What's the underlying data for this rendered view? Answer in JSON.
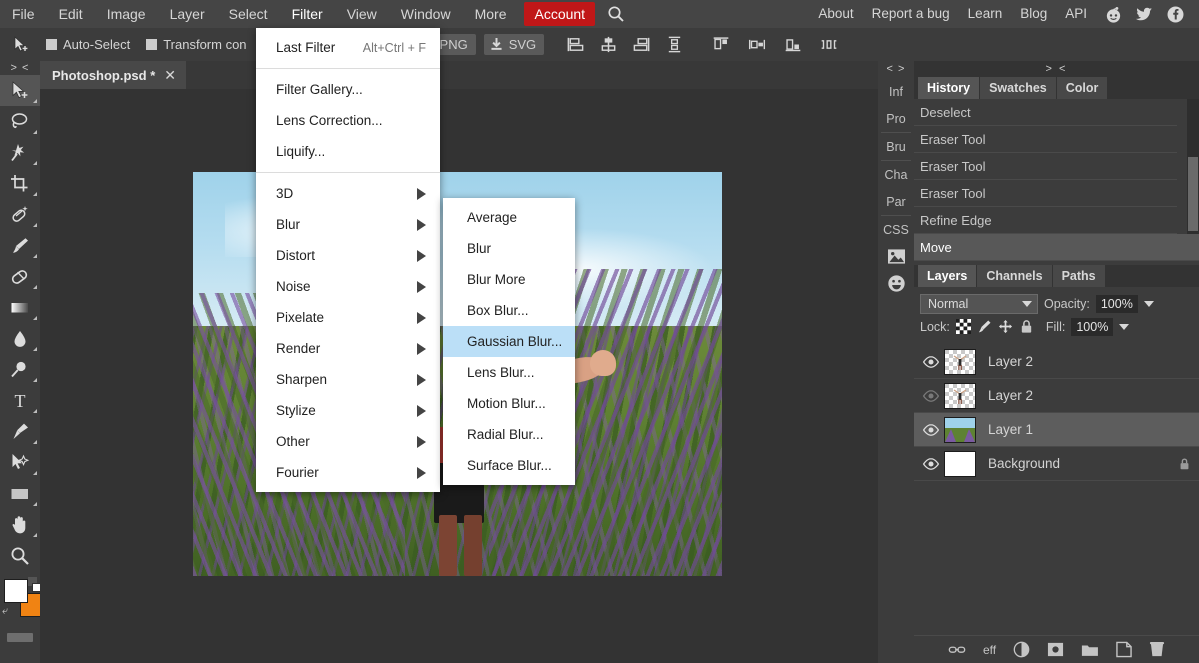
{
  "menubar": {
    "left_items": [
      "File",
      "Edit",
      "Image",
      "Layer",
      "Select",
      "Filter",
      "View",
      "Window",
      "More"
    ],
    "account_label": "Account",
    "search_icon": "search-icon",
    "right_items": [
      "About",
      "Report a bug",
      "Learn",
      "Blog",
      "API"
    ],
    "social_icons": [
      "reddit-icon",
      "twitter-icon",
      "facebook-icon"
    ],
    "accent_color": "#c01718"
  },
  "optionsbar": {
    "tool_icon": "move-tool-icon",
    "auto_select_label": "Auto-Select",
    "transform_label": "Transform con",
    "png_label": "PNG",
    "svg_label": "SVG",
    "align_icons": [
      "align-left-icon",
      "align-center-horizontal-icon",
      "align-right-icon",
      "distribute-vertical-icon"
    ],
    "align_icons2": [
      "align-top-icon",
      "align-middle-icon",
      "align-bottom-icon",
      "distribute-horizontal-icon"
    ]
  },
  "lefttools": {
    "collapse_label": "> <",
    "items": [
      {
        "name": "move-tool",
        "selected": true
      },
      {
        "name": "lasso-tool",
        "selected": false
      },
      {
        "name": "magic-wand-tool",
        "selected": false
      },
      {
        "name": "crop-tool",
        "selected": false
      },
      {
        "name": "healing-brush-tool",
        "selected": false
      },
      {
        "name": "brush-tool",
        "selected": false
      },
      {
        "name": "eraser-tool",
        "selected": false
      },
      {
        "name": "gradient-tool",
        "selected": false
      },
      {
        "name": "blur-tool",
        "selected": false
      },
      {
        "name": "dodge-tool",
        "selected": false
      },
      {
        "name": "type-tool",
        "selected": false
      },
      {
        "name": "pen-tool",
        "selected": false
      },
      {
        "name": "path-selection-tool",
        "selected": false
      },
      {
        "name": "rectangle-tool",
        "selected": false
      },
      {
        "name": "hand-tool",
        "selected": false
      },
      {
        "name": "zoom-tool",
        "selected": false
      }
    ],
    "foreground_color": "#ffffff",
    "background_color": "#f08313"
  },
  "document": {
    "tab_name": "Photoshop.psd *",
    "close_label": "✕"
  },
  "filter_menu": {
    "rows": [
      {
        "label": "Last Filter",
        "shortcut": "Alt+Ctrl + F",
        "submenu": false
      },
      {
        "separator": true
      },
      {
        "label": "Filter Gallery...",
        "shortcut": "",
        "submenu": false
      },
      {
        "label": "Lens Correction...",
        "shortcut": "",
        "submenu": false
      },
      {
        "label": "Liquify...",
        "shortcut": "",
        "submenu": false
      },
      {
        "separator": true
      },
      {
        "label": "3D",
        "shortcut": "",
        "submenu": true
      },
      {
        "label": "Blur",
        "shortcut": "",
        "submenu": true
      },
      {
        "label": "Distort",
        "shortcut": "",
        "submenu": true
      },
      {
        "label": "Noise",
        "shortcut": "",
        "submenu": true
      },
      {
        "label": "Pixelate",
        "shortcut": "",
        "submenu": true
      },
      {
        "label": "Render",
        "shortcut": "",
        "submenu": true
      },
      {
        "label": "Sharpen",
        "shortcut": "",
        "submenu": true
      },
      {
        "label": "Stylize",
        "shortcut": "",
        "submenu": true
      },
      {
        "label": "Other",
        "shortcut": "",
        "submenu": true
      },
      {
        "label": "Fourier",
        "shortcut": "",
        "submenu": true
      }
    ]
  },
  "blur_submenu": {
    "items": [
      {
        "label": "Average",
        "highlighted": false
      },
      {
        "label": "Blur",
        "highlighted": false
      },
      {
        "label": "Blur More",
        "highlighted": false
      },
      {
        "label": "Box Blur...",
        "highlighted": false
      },
      {
        "label": "Gaussian Blur...",
        "highlighted": true
      },
      {
        "label": "Lens Blur...",
        "highlighted": false
      },
      {
        "label": "Motion Blur...",
        "highlighted": false
      },
      {
        "label": "Radial Blur...",
        "highlighted": false
      },
      {
        "label": "Surface Blur...",
        "highlighted": false
      }
    ],
    "highlight_color": "#bbdff7"
  },
  "minibar": {
    "collapse_label": "< >",
    "items": [
      "Inf",
      "Pro",
      "Bru",
      "Cha",
      "Par",
      "CSS"
    ],
    "icon_items": [
      "image-icon",
      "emoji-icon"
    ]
  },
  "history_panel": {
    "collapse_label": "> <",
    "tabs": [
      {
        "label": "History",
        "selected": true
      },
      {
        "label": "Swatches",
        "selected": false
      },
      {
        "label": "Color",
        "selected": false
      }
    ],
    "items": [
      {
        "label": "Deselect",
        "selected": false
      },
      {
        "label": "Eraser Tool",
        "selected": false
      },
      {
        "label": "Eraser Tool",
        "selected": false
      },
      {
        "label": "Eraser Tool",
        "selected": false
      },
      {
        "label": "Refine Edge",
        "selected": false
      },
      {
        "label": "Move",
        "selected": true
      }
    ]
  },
  "layers_panel": {
    "tabs": [
      {
        "label": "Layers",
        "selected": true
      },
      {
        "label": "Channels",
        "selected": false
      },
      {
        "label": "Paths",
        "selected": false
      }
    ],
    "blend_mode": "Normal",
    "opacity_label": "Opacity:",
    "opacity_value": "100%",
    "lock_label": "Lock:",
    "lock_icons": [
      "lock-transparent-icon",
      "lock-image-icon",
      "lock-position-icon",
      "lock-all-icon"
    ],
    "fill_label": "Fill:",
    "fill_value": "100%",
    "layers": [
      {
        "name": "Layer 2",
        "visible": true,
        "selected": false,
        "locked": false,
        "thumb": "transparent"
      },
      {
        "name": "Layer 2",
        "visible": false,
        "selected": false,
        "locked": false,
        "thumb": "transparent"
      },
      {
        "name": "Layer 1",
        "visible": true,
        "selected": true,
        "locked": false,
        "thumb": "image"
      },
      {
        "name": "Background",
        "visible": true,
        "selected": false,
        "locked": true,
        "thumb": "white"
      }
    ],
    "footer_icons": [
      "link-layers-icon",
      "layer-effects-icon",
      "adjustment-layer-icon",
      "layer-mask-icon",
      "new-group-icon",
      "new-layer-icon",
      "delete-layer-icon"
    ],
    "footer_effects_label": "eff"
  },
  "canvas": {
    "artboard_description": "lavender-field-photo"
  }
}
